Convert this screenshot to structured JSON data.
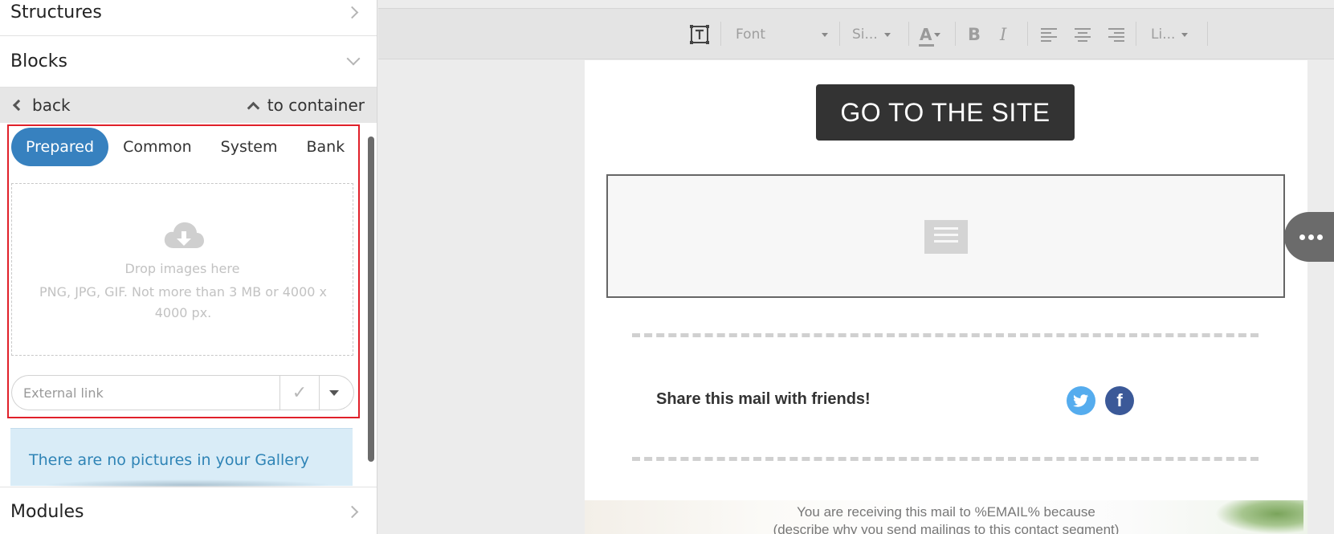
{
  "sidebar": {
    "structures_label": "Structures",
    "blocks_label": "Blocks",
    "modules_label": "Modules",
    "nav": {
      "back": "back",
      "to_container": "to container"
    },
    "tabs": [
      {
        "label": "Prepared",
        "active": true
      },
      {
        "label": "Common",
        "active": false
      },
      {
        "label": "System",
        "active": false
      },
      {
        "label": "Bank",
        "active": false
      }
    ],
    "dropzone": {
      "title": "Drop images here",
      "subtitle": "PNG, JPG, GIF. Not more than 3 MB or 4000 x 4000 px."
    },
    "external_link": {
      "placeholder": "External link",
      "value": ""
    },
    "gallery_note": "There are no pictures in your Gallery"
  },
  "toolbar": {
    "font": "Font",
    "size": "Si...",
    "line_height": "Li...",
    "icons": [
      "text-frame-icon",
      "font-color-icon",
      "bold-icon",
      "italic-icon",
      "align-left-icon",
      "align-center-icon",
      "align-right-icon"
    ]
  },
  "canvas": {
    "button_label": "GO TO THE SITE",
    "share_text": "Share this mail with friends!",
    "social": [
      "twitter-icon",
      "facebook-icon"
    ],
    "footer_line1": "You are receiving this mail to %EMAIL% because",
    "footer_line2": "(describe why you send mailings to this contact segment)"
  },
  "colors": {
    "accent": "#3781bf",
    "highlight_border": "#e0202a",
    "button_bg": "#333333",
    "twitter": "#55acee",
    "facebook": "#3b5998"
  }
}
